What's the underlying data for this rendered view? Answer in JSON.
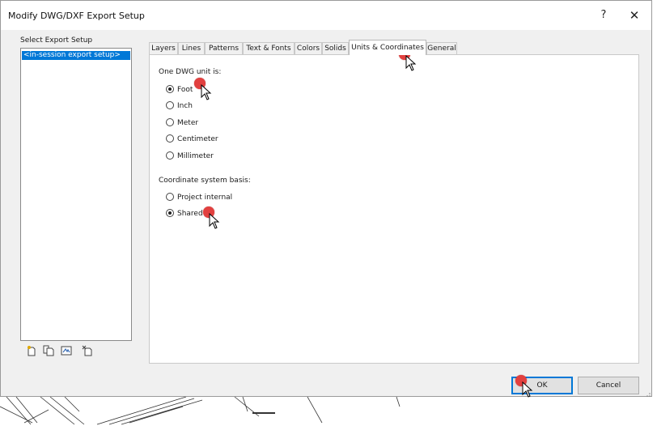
{
  "window": {
    "title": "Modify DWG/DXF Export Setup",
    "help_label": "?",
    "close_label": "✕"
  },
  "setup": {
    "label": "Select Export Setup",
    "items": [
      "<in-session export setup>"
    ],
    "tool_icons": [
      "new-setup-icon",
      "duplicate-setup-icon",
      "rename-setup-icon",
      "delete-setup-icon"
    ]
  },
  "tabs": [
    {
      "label": "Layers",
      "active": false
    },
    {
      "label": "Lines",
      "active": false
    },
    {
      "label": "Patterns",
      "active": false
    },
    {
      "label": "Text & Fonts",
      "active": false
    },
    {
      "label": "Colors",
      "active": false
    },
    {
      "label": "Solids",
      "active": false
    },
    {
      "label": "Units & Coordinates",
      "active": true
    },
    {
      "label": "General",
      "active": false
    }
  ],
  "units": {
    "label": "One DWG unit is:",
    "options": [
      {
        "label": "Foot",
        "checked": true
      },
      {
        "label": "Inch",
        "checked": false
      },
      {
        "label": "Meter",
        "checked": false
      },
      {
        "label": "Centimeter",
        "checked": false
      },
      {
        "label": "Millimeter",
        "checked": false
      }
    ]
  },
  "coordinates": {
    "label": "Coordinate system basis:",
    "options": [
      {
        "label": "Project internal",
        "checked": false
      },
      {
        "label": "Shared",
        "checked": true
      }
    ]
  },
  "buttons": {
    "ok": "OK",
    "cancel": "Cancel"
  },
  "colors": {
    "accent": "#0078d7",
    "marker": "#e2403f"
  }
}
